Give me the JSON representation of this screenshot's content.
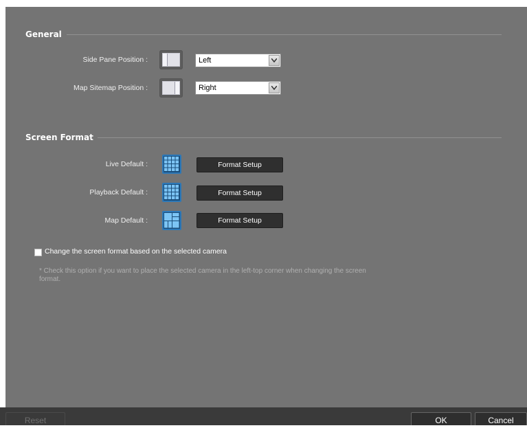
{
  "general": {
    "title": "General",
    "side_pane": {
      "label": "Side Pane Position :",
      "value": "Left"
    },
    "map_sitemap": {
      "label": "Map Sitemap Position :",
      "value": "Right"
    }
  },
  "screen_format": {
    "title": "Screen Format",
    "live": {
      "label": "Live Default :",
      "button": "Format Setup"
    },
    "playback": {
      "label": "Playback Default :",
      "button": "Format Setup"
    },
    "map": {
      "label": "Map Default :",
      "button": "Format Setup"
    },
    "checkbox_label": "Change the screen format based on the selected camera",
    "checkbox_checked": false,
    "note": "* Check this option if you want to place the selected camera in the left-top corner when changing the screen format."
  },
  "footer": {
    "reset": "Reset",
    "ok": "OK",
    "cancel": "Cancel"
  },
  "colors": {
    "panel_bg": "#747474",
    "icon_blue": "#2c78b8",
    "button_dark": "#2f2f2f"
  }
}
